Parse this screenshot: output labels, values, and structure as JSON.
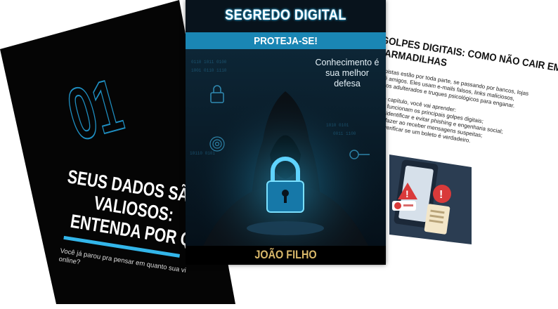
{
  "left_page": {
    "chapter_number": "01",
    "heading_lines": [
      "SEUS DADOS SÃO",
      "VALIOSOS:",
      "ENTENDA POR Q"
    ],
    "intro_lines": [
      "Você já parou pra pensar em quanto sua vi",
      "online?"
    ]
  },
  "cover": {
    "title": "SEGREDO DIGITAL",
    "subtitle": "PROTEJA-SE!",
    "tagline_lines": [
      "Conhecimento é",
      "sua melhor",
      "defesa"
    ],
    "author": "JOÃO FILHO"
  },
  "right_page": {
    "heading_lines": [
      "GOLPES DIGITAIS: COMO NÃO CAIR EM",
      "ARMADILHAS"
    ],
    "paragraph_lines": [
      "Golpistas estão por toda parte, se passando por bancos, lojas",
      "e até amigos. Eles usam e-mails falsos, links maliciosos,",
      "boletos adulterados e truques psicológicos para enganar."
    ],
    "list_intro": "Neste capítulo, você vai aprender:",
    "list_items": [
      "Como funcionam os principais golpes digitais;",
      "Como identificar e evitar phishing e engenharia social;",
      "O que fazer ao receber mensagens suspeitas;",
      "Como verificar se um boleto é verdadeiro."
    ]
  },
  "colors": {
    "accent_cyan": "#33b6ea",
    "cover_band": "#1a86b4",
    "author_gold": "#d9b86a",
    "warning_red": "#d93a3a"
  }
}
